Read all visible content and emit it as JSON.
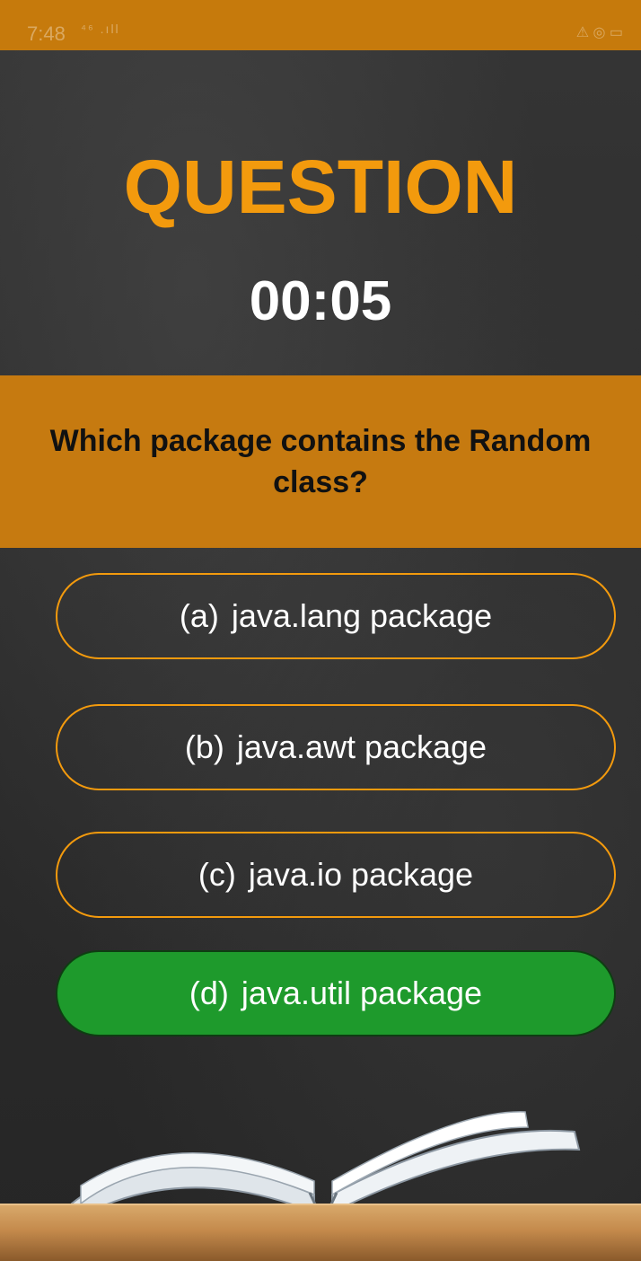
{
  "status_bar": {
    "time": "7:48",
    "signal": "⁴⁶ .ıll",
    "right": "⚠ ◎ ▭"
  },
  "quiz": {
    "title": "QUESTION",
    "timer": "00:05",
    "question": "Which package contains the Random class?",
    "options": [
      {
        "letter": "(a)",
        "text": "java.lang package"
      },
      {
        "letter": "(b)",
        "text": "java.awt package"
      },
      {
        "letter": "(c)",
        "text": "java.io package"
      },
      {
        "letter": "(d)",
        "text": "java.util package"
      }
    ],
    "correct_option": "(d)"
  },
  "colors": {
    "accent": "#f39a0d",
    "band": "#c67a10",
    "correct": "#1e9a2c"
  }
}
